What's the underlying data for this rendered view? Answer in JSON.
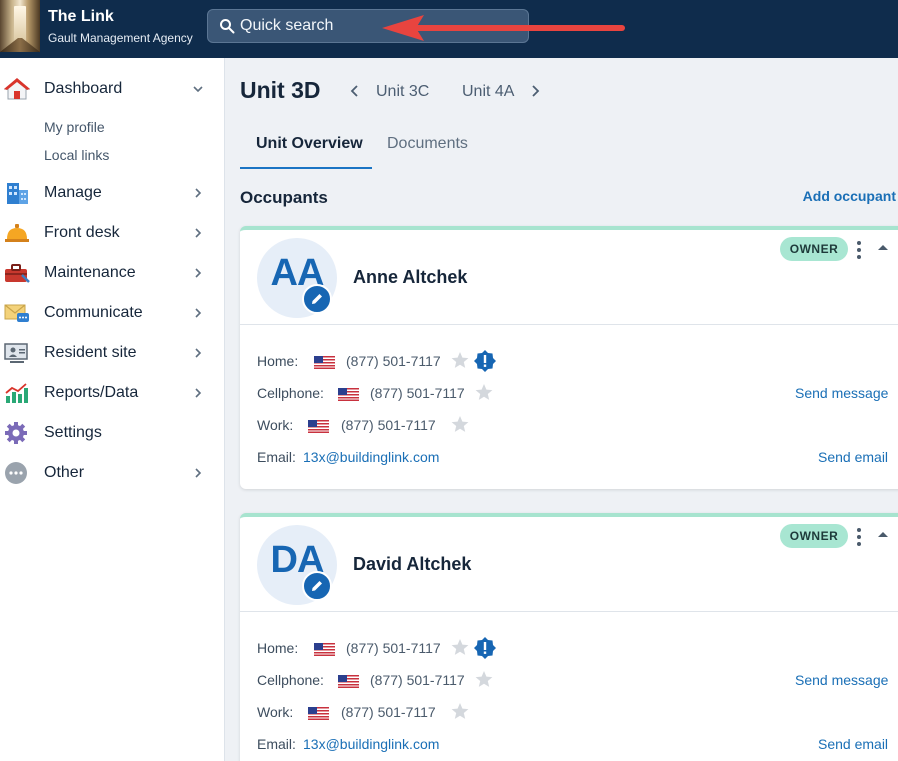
{
  "app": {
    "title": "The Link",
    "subtitle": "Gault Management Agency"
  },
  "search": {
    "placeholder": "Quick search",
    "value": ""
  },
  "sidebar": {
    "dashboard": "Dashboard",
    "dashboard_sub": [
      "My profile",
      "Local links"
    ],
    "items": [
      "Manage",
      "Front desk",
      "Maintenance",
      "Communicate",
      "Resident site",
      "Reports/Data",
      "Settings",
      "Other"
    ]
  },
  "unit": {
    "title": "Unit 3D",
    "prev": "Unit 3C",
    "next": "Unit 4A"
  },
  "tabs": [
    "Unit Overview",
    "Documents"
  ],
  "occupants": {
    "title": "Occupants",
    "add_label": "Add occupant",
    "labels": {
      "home": "Home:",
      "cell": "Cellphone:",
      "work": "Work:",
      "email": "Email:"
    },
    "actions": {
      "message": "Send message",
      "email": "Send email"
    },
    "list": [
      {
        "initials": "AA",
        "name": "Anne Altchek",
        "badge": "OWNER",
        "home": "(877) 501-7117",
        "cell": "(877) 501-7117",
        "work": "(877) 501-7117",
        "email": "13x@buildinglink.com"
      },
      {
        "initials": "DA",
        "name": "David Altchek",
        "badge": "OWNER",
        "home": "(877) 501-7117",
        "cell": "(877) 501-7117",
        "work": "(877) 501-7117",
        "email": "13x@buildinglink.com"
      }
    ]
  },
  "colors": {
    "topbar": "#0f2c4c",
    "accent": "#1a6fb6",
    "badge": "#a8e6d2",
    "annotation_arrow": "#e8443f"
  }
}
